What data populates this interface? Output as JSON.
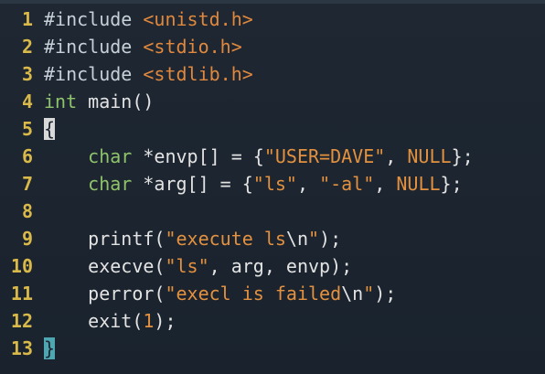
{
  "editor": {
    "lines": [
      {
        "no": "1",
        "tokens": [
          {
            "t": "#include ",
            "c": "pp"
          },
          {
            "t": "<unistd.h>",
            "c": "inc"
          }
        ]
      },
      {
        "no": "2",
        "tokens": [
          {
            "t": "#include ",
            "c": "pp"
          },
          {
            "t": "<stdio.h>",
            "c": "inc"
          }
        ]
      },
      {
        "no": "3",
        "tokens": [
          {
            "t": "#include ",
            "c": "pp"
          },
          {
            "t": "<stdlib.h>",
            "c": "inc"
          }
        ]
      },
      {
        "no": "4",
        "tokens": [
          {
            "t": "int",
            "c": "type"
          },
          {
            "t": " main()",
            "c": "plain"
          }
        ]
      },
      {
        "no": "5",
        "tokens": [
          {
            "t": "{",
            "c": "cursor"
          }
        ]
      },
      {
        "no": "6",
        "tokens": [
          {
            "t": "    ",
            "c": "plain"
          },
          {
            "t": "char",
            "c": "type"
          },
          {
            "t": " *envp[] = {",
            "c": "plain"
          },
          {
            "t": "\"USER=DAVE\"",
            "c": "str"
          },
          {
            "t": ", ",
            "c": "plain"
          },
          {
            "t": "NULL",
            "c": "str"
          },
          {
            "t": "};",
            "c": "plain"
          }
        ]
      },
      {
        "no": "7",
        "tokens": [
          {
            "t": "    ",
            "c": "plain"
          },
          {
            "t": "char",
            "c": "type"
          },
          {
            "t": " *arg[] = {",
            "c": "plain"
          },
          {
            "t": "\"ls\"",
            "c": "str"
          },
          {
            "t": ", ",
            "c": "plain"
          },
          {
            "t": "\"-al\"",
            "c": "str"
          },
          {
            "t": ", ",
            "c": "plain"
          },
          {
            "t": "NULL",
            "c": "str"
          },
          {
            "t": "};",
            "c": "plain"
          }
        ]
      },
      {
        "no": "8",
        "tokens": []
      },
      {
        "no": "9",
        "tokens": [
          {
            "t": "    printf(",
            "c": "plain"
          },
          {
            "t": "\"execute ls",
            "c": "str"
          },
          {
            "t": "\\n",
            "c": "plain"
          },
          {
            "t": "\"",
            "c": "str"
          },
          {
            "t": ");",
            "c": "plain"
          }
        ]
      },
      {
        "no": "10",
        "tokens": [
          {
            "t": "    execve(",
            "c": "plain"
          },
          {
            "t": "\"ls\"",
            "c": "str"
          },
          {
            "t": ", arg, envp);",
            "c": "plain"
          }
        ]
      },
      {
        "no": "11",
        "tokens": [
          {
            "t": "    perror(",
            "c": "plain"
          },
          {
            "t": "\"execl is failed",
            "c": "str"
          },
          {
            "t": "\\n",
            "c": "plain"
          },
          {
            "t": "\"",
            "c": "str"
          },
          {
            "t": ");",
            "c": "plain"
          }
        ]
      },
      {
        "no": "12",
        "tokens": [
          {
            "t": "    exit(",
            "c": "plain"
          },
          {
            "t": "1",
            "c": "num"
          },
          {
            "t": ");",
            "c": "plain"
          }
        ]
      },
      {
        "no": "13",
        "tokens": [
          {
            "t": "}",
            "c": "closebrace"
          }
        ]
      }
    ]
  }
}
